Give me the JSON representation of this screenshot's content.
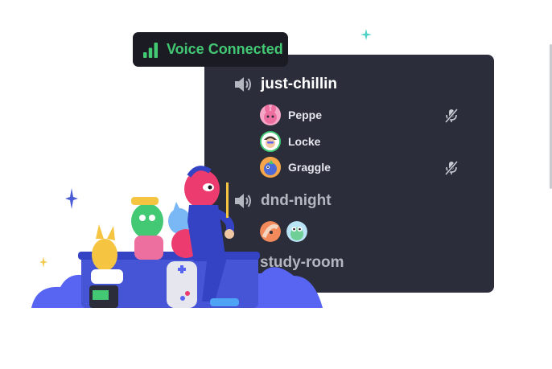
{
  "voice_status": {
    "label": "Voice Connected",
    "icon": "signal-bars-icon",
    "color": "#43c873"
  },
  "channels": [
    {
      "name": "just-chillin",
      "icon": "speaker-icon",
      "state": "active",
      "members": [
        {
          "name": "Peppe",
          "muted": true
        },
        {
          "name": "Locke",
          "muted": false
        },
        {
          "name": "Graggle",
          "muted": true
        }
      ]
    },
    {
      "name": "dnd-night",
      "icon": "speaker-icon",
      "state": "idle"
    },
    {
      "name": "study-room",
      "state": "idle"
    }
  ],
  "colors": {
    "panel": "#2b2d3b",
    "pill": "#1a1b23",
    "accent_green": "#43c873",
    "sparkle_teal": "#4fd1c5",
    "blurple": "#5865f2"
  }
}
